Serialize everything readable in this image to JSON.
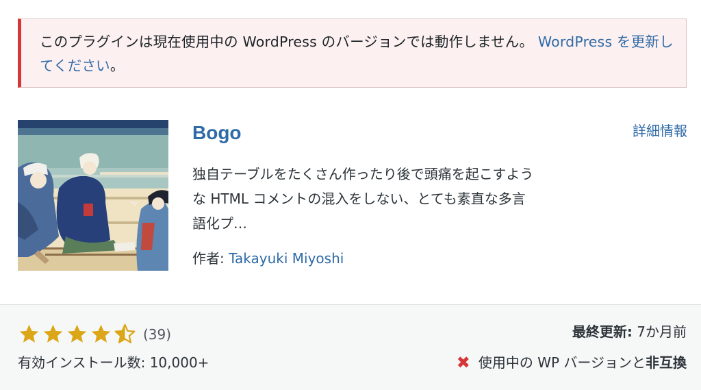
{
  "notice": {
    "message": "このプラグインは現在使用中の WordPress のバージョンでは動作しません。",
    "link_text": "WordPress を更新してください",
    "suffix": "。"
  },
  "plugin": {
    "name": "Bogo",
    "details_link": "詳細情報",
    "description": "独自テーブルをたくさん作ったり後で頭痛を起こすような HTML コメントの混入をしない、とても素直な多言語化プ…",
    "author_label": "作者: ",
    "author_name": "Takayuki Miyoshi"
  },
  "footer": {
    "rating_stars": 4.5,
    "rating_count": "(39)",
    "installs": "有効インストール数: 10,000+",
    "updated_label": "最終更新:",
    "updated_value": " 7か月前",
    "compat_text": "使用中の WP バージョンと",
    "compat_status": "非互換",
    "star_color": "#dba617",
    "error_color": "#d63638",
    "link_color": "#2e6aa6"
  }
}
